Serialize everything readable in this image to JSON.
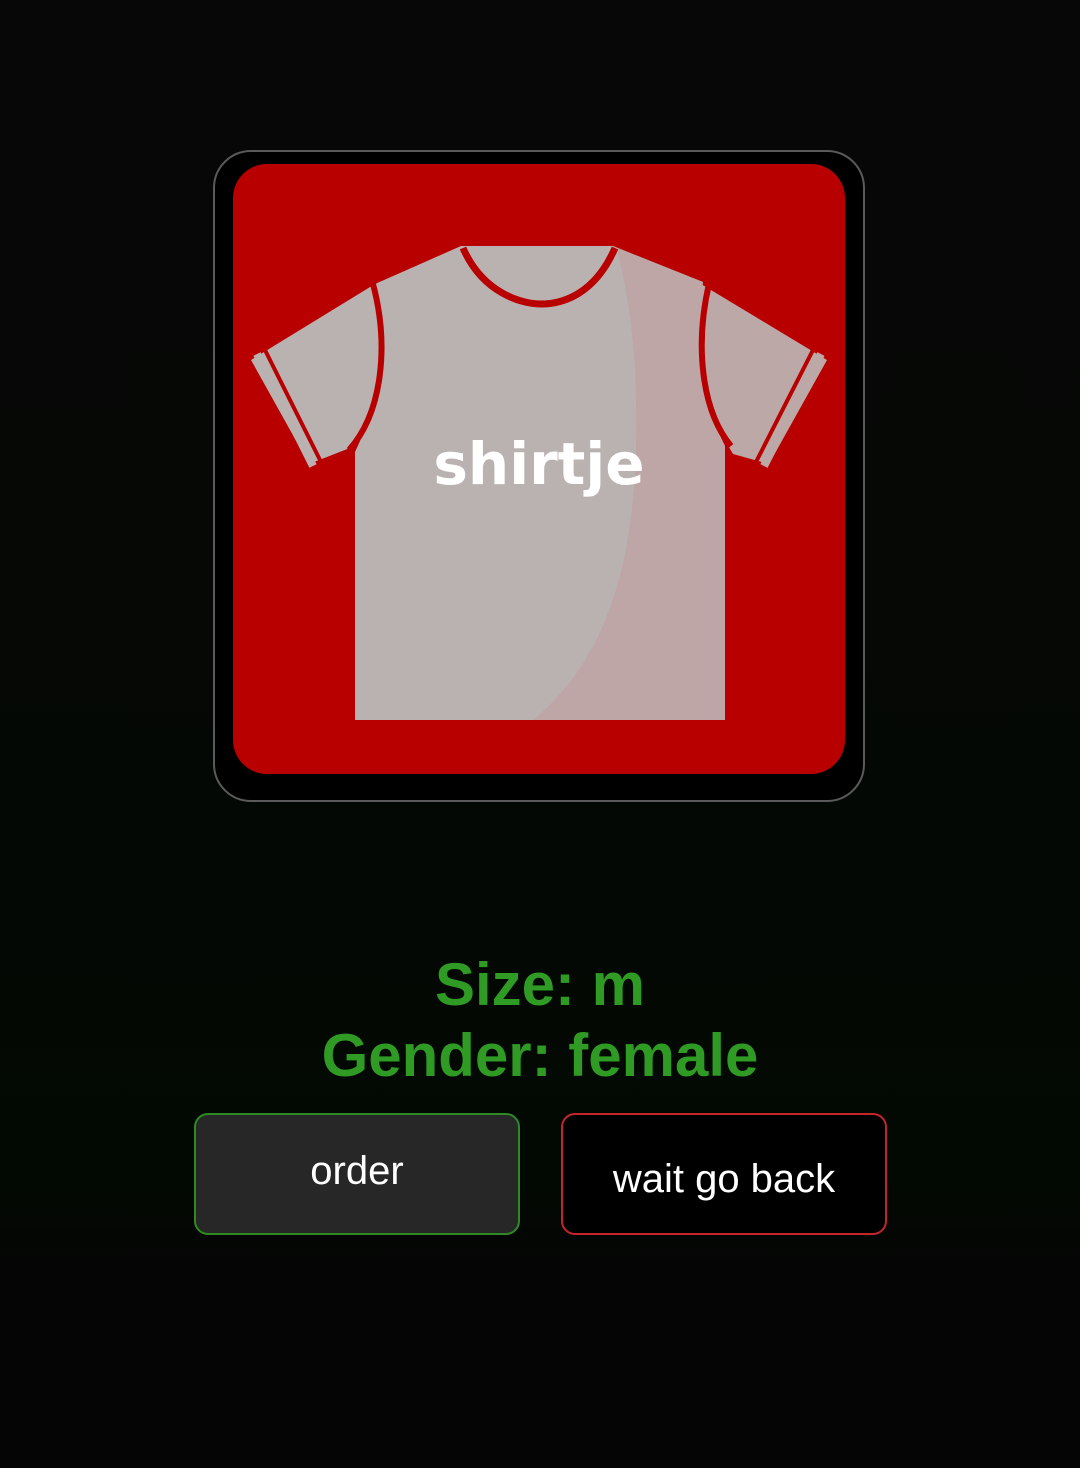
{
  "product": {
    "name": "shirtje",
    "image_icon": "tshirt-icon"
  },
  "details": {
    "size_text": "Size: m",
    "gender_text": "Gender: female"
  },
  "actions": {
    "order_label": "order",
    "back_label": "wait go back"
  },
  "colors": {
    "card_background": "#b80000",
    "shirt": "#bab2b1",
    "info_text": "#2f9a24",
    "order_border": "#2d8a24",
    "back_border": "#c3252b"
  }
}
